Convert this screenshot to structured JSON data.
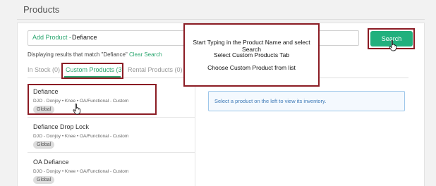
{
  "page": {
    "title": "Products"
  },
  "search": {
    "label": "Add Product -",
    "value": "Defiance",
    "button_label": "Search"
  },
  "results": {
    "text": "Displaying results that match \"Defiance\"",
    "clear_label": "Clear Search"
  },
  "tabs": [
    {
      "label": "In Stock (0)",
      "active": false
    },
    {
      "label": "Custom Products (3)",
      "active": true
    },
    {
      "label": "Rental Products (0)",
      "active": false
    }
  ],
  "products": [
    {
      "name": "Defiance",
      "description": "DJO - Donjoy • Knee • OA/Functional - Custom",
      "badge": "Global"
    },
    {
      "name": "Defiance Drop Lock",
      "description": "DJO - Donjoy • Knee • OA/Functional - Custom",
      "badge": "Global"
    },
    {
      "name": "OA Defiance",
      "description": "DJO - Donjoy • Knee • OA/Functional - Custom",
      "badge": "Global"
    }
  ],
  "info": {
    "text": "Select a product on the left to view its inventory."
  },
  "callout": {
    "lines": [
      "Start Typing in the Product Name and select Search",
      "Select Custom Products Tab",
      "Choose Custom Product from list"
    ]
  },
  "colors": {
    "accent": "#21b07d",
    "highlight": "#8b1c24",
    "info": "#3b78b6"
  },
  "icons": {
    "cursor": "hand-pointer-icon"
  }
}
